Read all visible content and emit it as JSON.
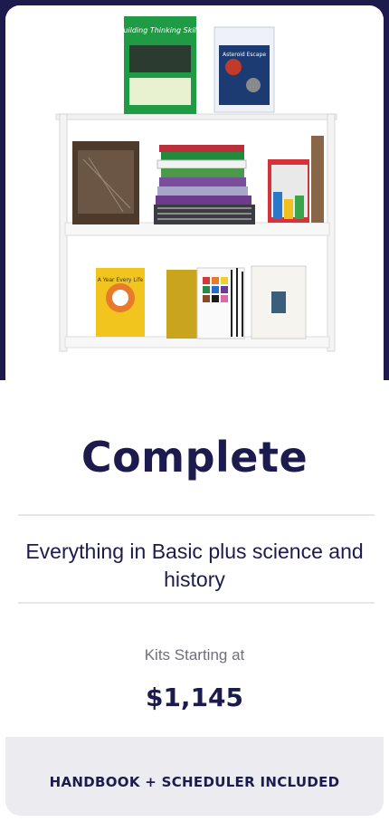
{
  "plan": {
    "title": "Complete",
    "description": "Everything in Basic plus science and history",
    "price_label": "Kits Starting at",
    "price": "$1,145",
    "footer_note": "HANDBOOK + SCHEDULER INCLUDED"
  },
  "shelf_items": {
    "book_top_left_title": "Building Thinking Skills",
    "game_top_right_title": "Asteroid Escape",
    "book_bottom_left_title": "A Year Every Life"
  },
  "colors": {
    "navy": "#1d1b4d",
    "footer_bg": "#ececf0",
    "divider": "#e6e6ea",
    "muted_text": "#6f6f7c"
  }
}
